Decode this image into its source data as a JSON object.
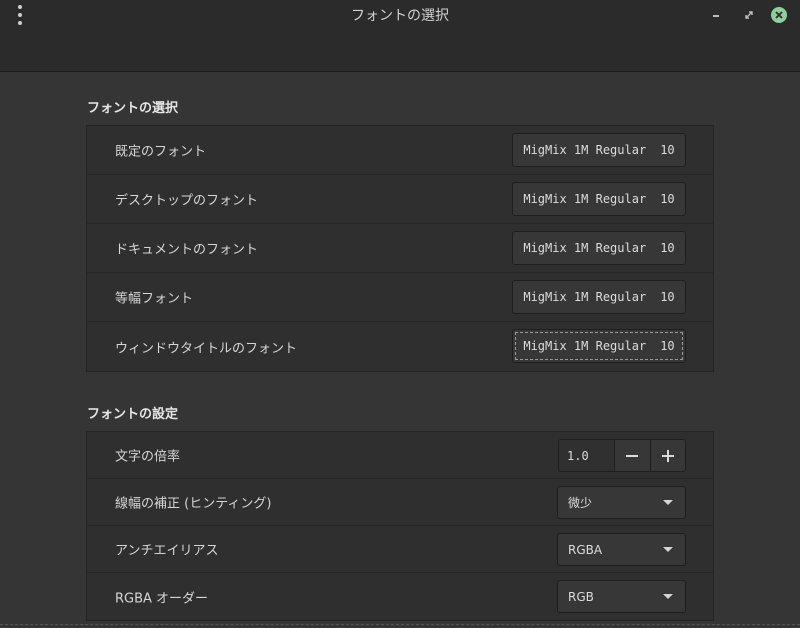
{
  "window": {
    "title": "フォントの選択",
    "icons": {
      "menu": "kebab-menu-icon",
      "minimize": "minimize-icon",
      "restore": "restore-icon",
      "close": "close-icon"
    },
    "close_color": "#8fcf9e"
  },
  "font_selection": {
    "title": "フォントの選択",
    "rows": [
      {
        "label": "既定のフォント",
        "font": "MigMix 1M Regular",
        "size": "10"
      },
      {
        "label": "デスクトップのフォント",
        "font": "MigMix 1M Regular",
        "size": "10"
      },
      {
        "label": "ドキュメントのフォント",
        "font": "MigMix 1M Regular",
        "size": "10"
      },
      {
        "label": "等幅フォント",
        "font": "MigMix 1M Regular",
        "size": "10"
      },
      {
        "label": "ウィンドウタイトルのフォント",
        "font": "MigMix 1M Regular",
        "size": "10"
      }
    ]
  },
  "font_settings": {
    "title": "フォントの設定",
    "scale": {
      "label": "文字の倍率",
      "value": "1.0",
      "minus": "−",
      "plus": "+"
    },
    "hinting": {
      "label": "線幅の補正 (ヒンティング)",
      "value": "微少"
    },
    "antialiasing": {
      "label": "アンチエイリアス",
      "value": "RGBA"
    },
    "rgba_order": {
      "label": "RGBA オーダー",
      "value": "RGB"
    }
  }
}
